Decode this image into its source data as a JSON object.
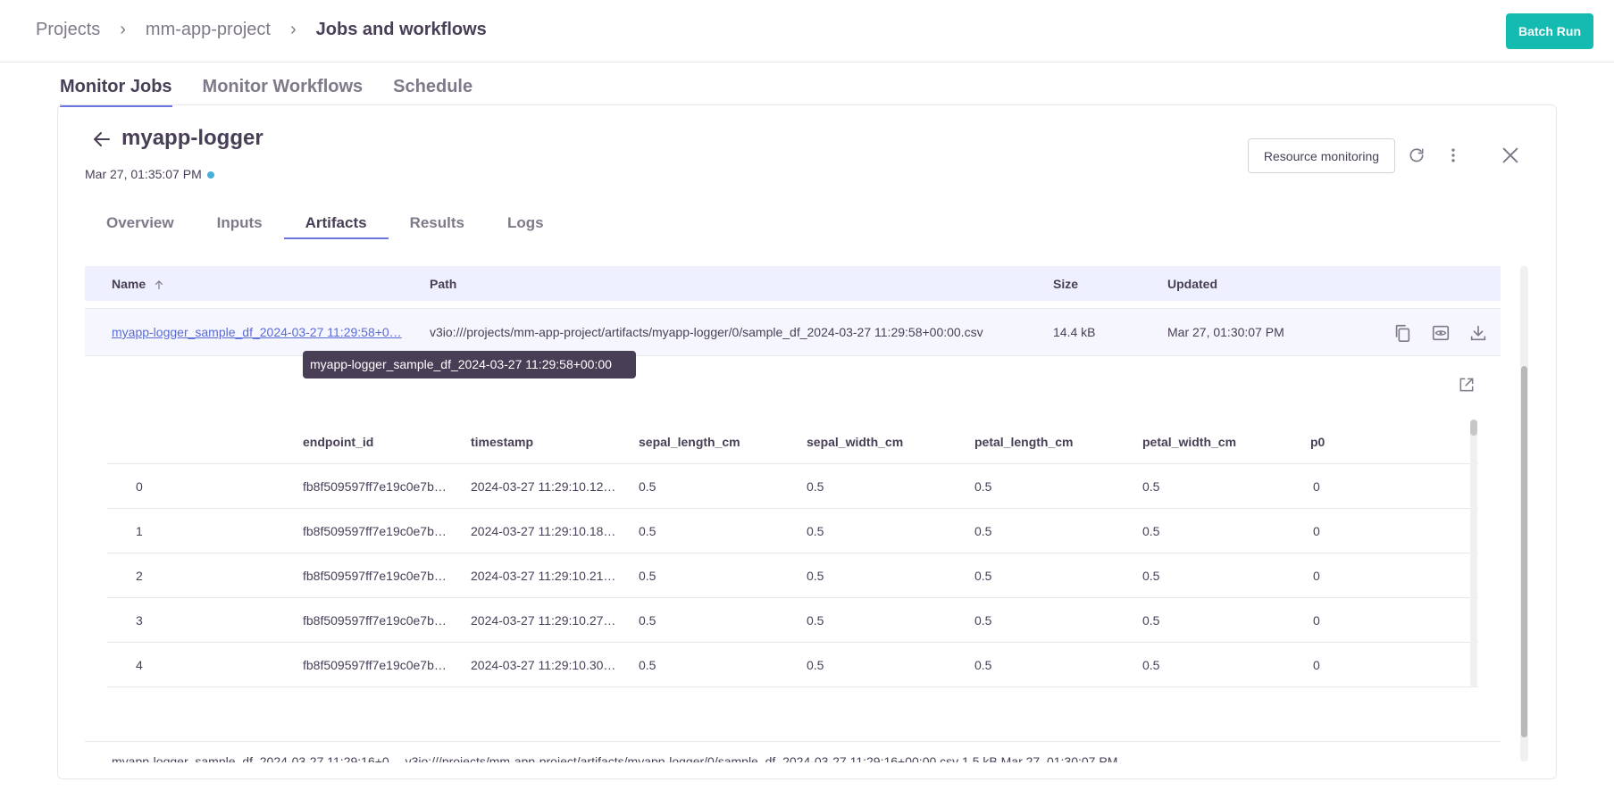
{
  "breadcrumb": [
    "Projects",
    "mm-app-project",
    "Jobs and workflows"
  ],
  "header": {
    "batch_run_label": "Batch Run"
  },
  "main_tabs": [
    "Monitor Jobs",
    "Monitor Workflows",
    "Schedule"
  ],
  "job": {
    "title": "myapp-logger",
    "date": "Mar 27, 01:35:07 PM",
    "status_color": "#49afd9",
    "resource_monitoring_label": "Resource monitoring"
  },
  "detail_tabs": [
    "Overview",
    "Inputs",
    "Artifacts",
    "Results",
    "Logs"
  ],
  "artifacts": {
    "columns": {
      "name": "Name",
      "path": "Path",
      "size": "Size",
      "updated": "Updated"
    },
    "row": {
      "name": "myapp-logger_sample_df_2024-03-27 11:29:58+0…",
      "path": "v3io:///projects/mm-app-project/artifacts/myapp-logger/0/sample_df_2024-03-27 11:29:58+00:00.csv",
      "size": "14.4 kB",
      "updated": "Mar 27, 01:30:07 PM"
    },
    "tooltip": "myapp-logger_sample_df_2024-03-27 11:29:58+00:00",
    "next_row_partial": "myapp-logger_sample_df_2024-03-27 11:29:16+0…   v3io:///projects/mm-app-project/artifacts/myapp-logger/0/sample_df_2024-03-27 11:29:16+00:00.csv   1.5 kB   Mar 27, 01:30:07 PM"
  },
  "preview": {
    "columns": [
      "",
      "endpoint_id",
      "timestamp",
      "sepal_length_cm",
      "sepal_width_cm",
      "petal_length_cm",
      "petal_width_cm",
      "p0"
    ],
    "rows": [
      [
        "0",
        "fb8f509597ff7e19c0e7b…",
        "2024-03-27 11:29:10.12…",
        "0.5",
        "0.5",
        "0.5",
        "0.5",
        "0"
      ],
      [
        "1",
        "fb8f509597ff7e19c0e7b…",
        "2024-03-27 11:29:10.18…",
        "0.5",
        "0.5",
        "0.5",
        "0.5",
        "0"
      ],
      [
        "2",
        "fb8f509597ff7e19c0e7b…",
        "2024-03-27 11:29:10.21…",
        "0.5",
        "0.5",
        "0.5",
        "0.5",
        "0"
      ],
      [
        "3",
        "fb8f509597ff7e19c0e7b…",
        "2024-03-27 11:29:10.27…",
        "0.5",
        "0.5",
        "0.5",
        "0.5",
        "0"
      ],
      [
        "4",
        "fb8f509597ff7e19c0e7b…",
        "2024-03-27 11:29:10.30…",
        "0.5",
        "0.5",
        "0.5",
        "0.5",
        "0"
      ]
    ]
  },
  "icons": [
    "chevron-right-icon",
    "back-arrow-icon",
    "refresh-icon",
    "more-vertical-icon",
    "close-icon",
    "sort-arrow-up-icon",
    "copy-icon",
    "preview-eye-icon",
    "download-icon",
    "popout-icon"
  ],
  "colors": {
    "accent": "#13bbb1",
    "tab_underline": "#6b75e0",
    "link": "#5a6bd8",
    "header_bg": "#eef1fd"
  }
}
